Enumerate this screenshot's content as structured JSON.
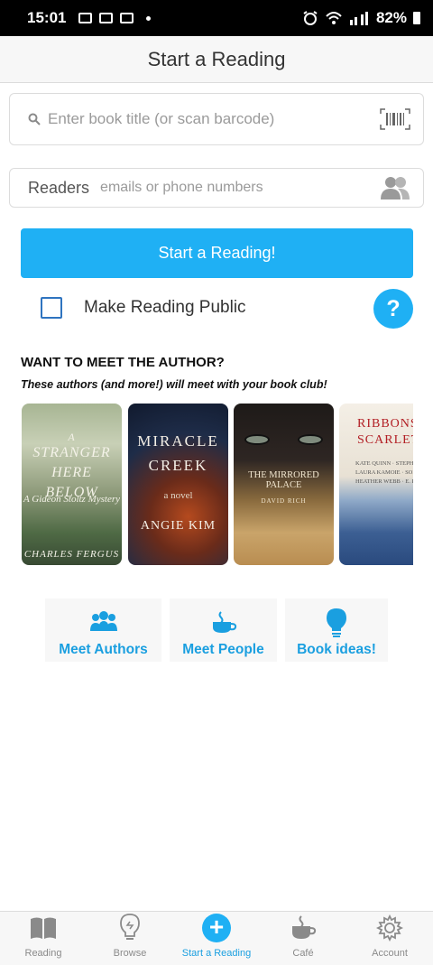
{
  "status_bar": {
    "time": "15:01",
    "battery": "82%"
  },
  "header": {
    "title": "Start a Reading"
  },
  "search": {
    "placeholder": "Enter book title (or scan barcode)"
  },
  "readers": {
    "label": "Readers",
    "placeholder": "emails or phone numbers"
  },
  "start_button": {
    "label": "Start a Reading!"
  },
  "make_public": {
    "label": "Make Reading Public",
    "checked": false
  },
  "help_button": {
    "label": "?"
  },
  "authors_section": {
    "heading": "WANT TO MEET THE AUTHOR?",
    "subheading": "These authors (and more!) will meet with your book club!"
  },
  "books": [
    {
      "title_l1": "STRANGER",
      "title_l2": "HERE",
      "title_l3": "BELOW",
      "title_a": "A",
      "subtitle": "A Gideon Stoltz Mystery",
      "author": "CHARLES FERGUS"
    },
    {
      "title_l1": "MIRACLE",
      "title_l2": "CREEK",
      "subtitle": "a novel",
      "author": "ANGIE KIM"
    },
    {
      "title": "THE MIRRORED PALACE",
      "author": "DAVID RICH"
    },
    {
      "title_l1": "RIBBONS",
      "title_l2": "SCARLET",
      "names_l1": "KATE QUINN · STEPHANIE",
      "names_l2": "LAURA KAMOIE · SOPHIE P",
      "names_l3": "HEATHER WEBB · E. KN"
    }
  ],
  "quick_links": [
    {
      "label": "Meet Authors",
      "icon": "people-group-icon"
    },
    {
      "label": "Meet People",
      "icon": "coffee-cup-icon"
    },
    {
      "label": "Book ideas!",
      "icon": "lightbulb-icon"
    }
  ],
  "tab_bar": [
    {
      "label": "Reading",
      "icon": "book-icon",
      "active": false
    },
    {
      "label": "Browse",
      "icon": "lightbulb-icon",
      "active": false
    },
    {
      "label": "Start a Reading",
      "icon": "plus-circle-icon",
      "active": true
    },
    {
      "label": "Café",
      "icon": "coffee-cup-icon",
      "active": false
    },
    {
      "label": "Account",
      "icon": "gear-icon",
      "active": false
    }
  ],
  "colors": {
    "accent": "#1fb0f4",
    "link_text": "#1a9fe0",
    "checkbox_border": "#2f74c0"
  }
}
